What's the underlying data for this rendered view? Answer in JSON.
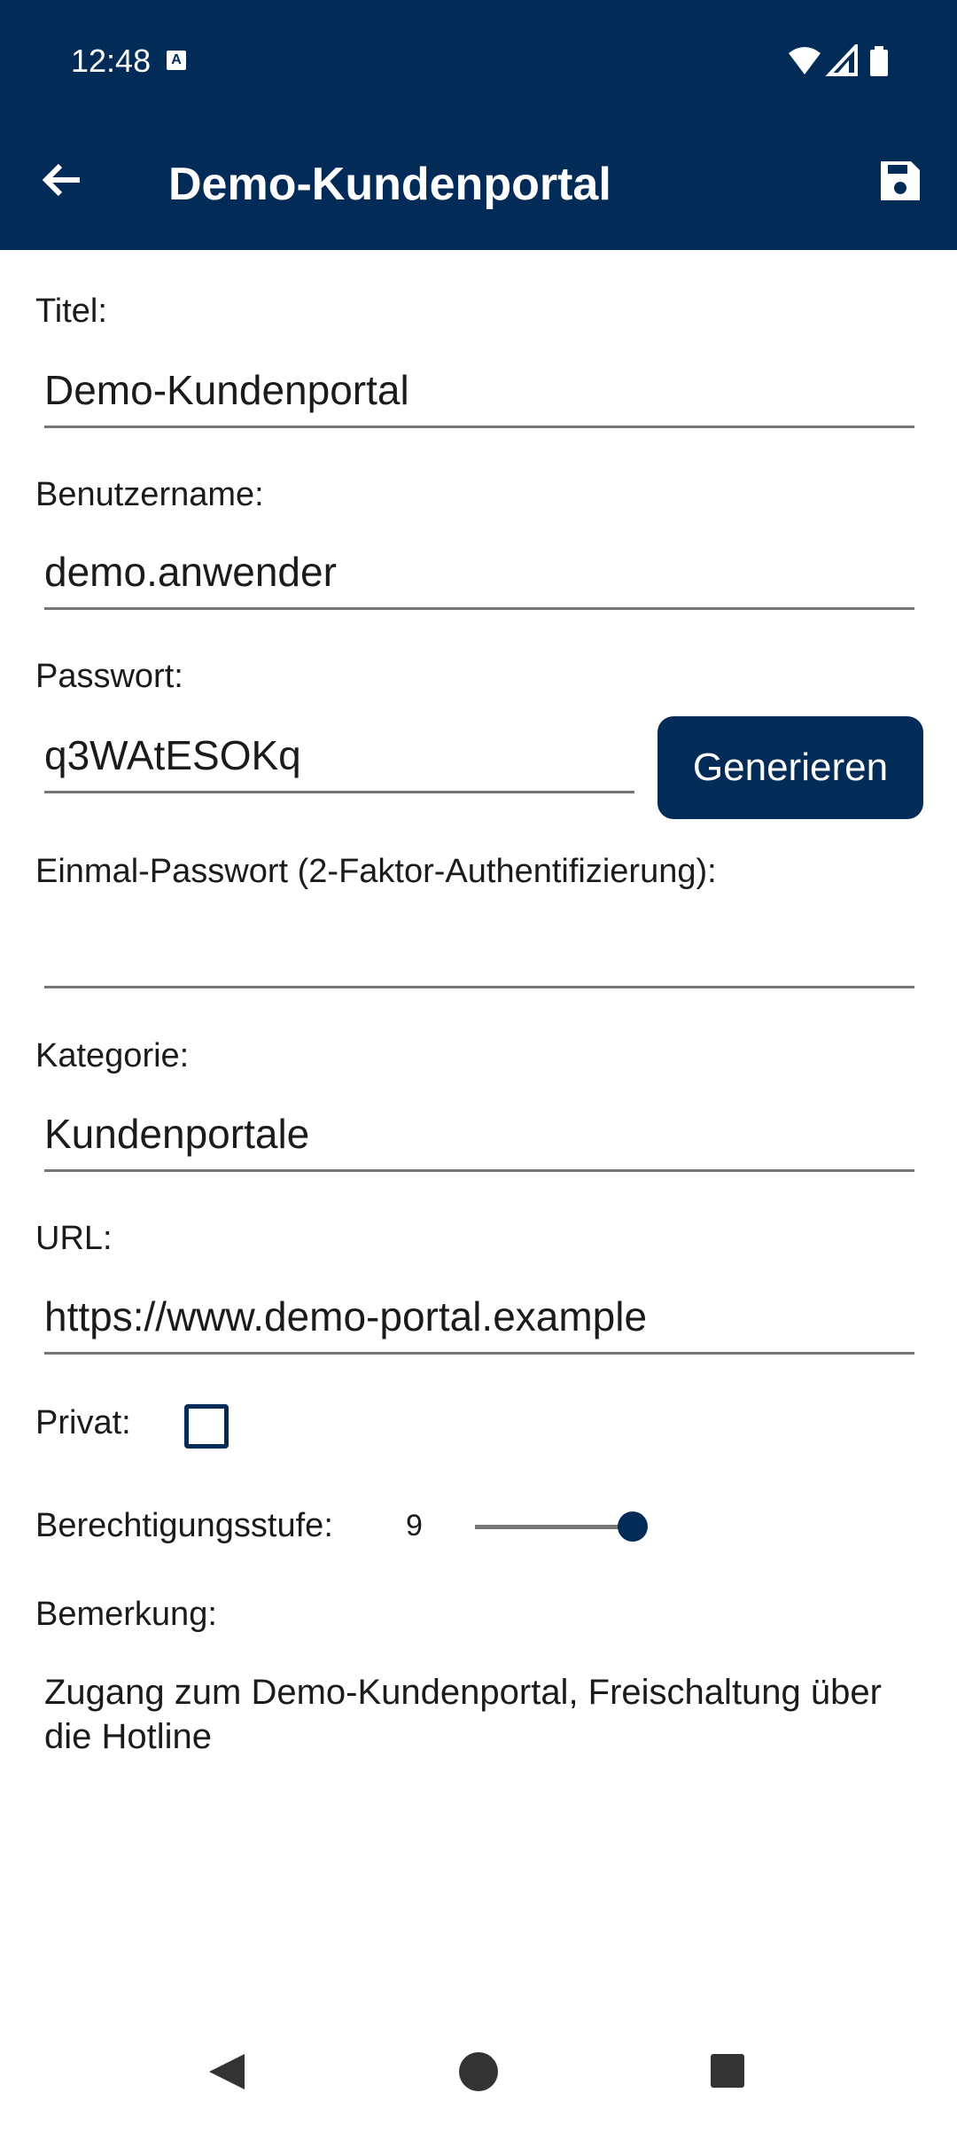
{
  "status_bar": {
    "time": "12:48",
    "notification_icon": "a-icon",
    "icons": [
      "wifi-icon",
      "signal-icon",
      "battery-icon"
    ]
  },
  "app_bar": {
    "title": "Demo-Kundenportal",
    "back_icon": "arrow-back-icon",
    "save_icon": "save-icon",
    "background_color": "#022b58"
  },
  "form": {
    "title_label": "Titel:",
    "title_value": "Demo-Kundenportal",
    "username_label": "Benutzername:",
    "username_value": "demo.anwender",
    "password_label": "Passwort:",
    "password_value": "q3WAtESOKq",
    "generate_label": "Generieren",
    "otp_label": "Einmal-Passwort (2-Faktor-Authentifizierung):",
    "otp_value": "",
    "category_label": "Kategorie:",
    "category_value": "Kundenportale",
    "url_label": "URL:",
    "url_value": "https://www.demo-portal.example",
    "private_label": "Privat:",
    "private_checked": false,
    "permission_label": "Berechtigungsstufe:",
    "permission_value": "9",
    "remark_label": "Bemerkung:",
    "remark_value": "Zugang zum Demo-Kundenportal, Freischaltung über die Hotline"
  },
  "nav_bar": {
    "icons": [
      "back-triangle-icon",
      "home-circle-icon",
      "recents-square-icon"
    ]
  }
}
